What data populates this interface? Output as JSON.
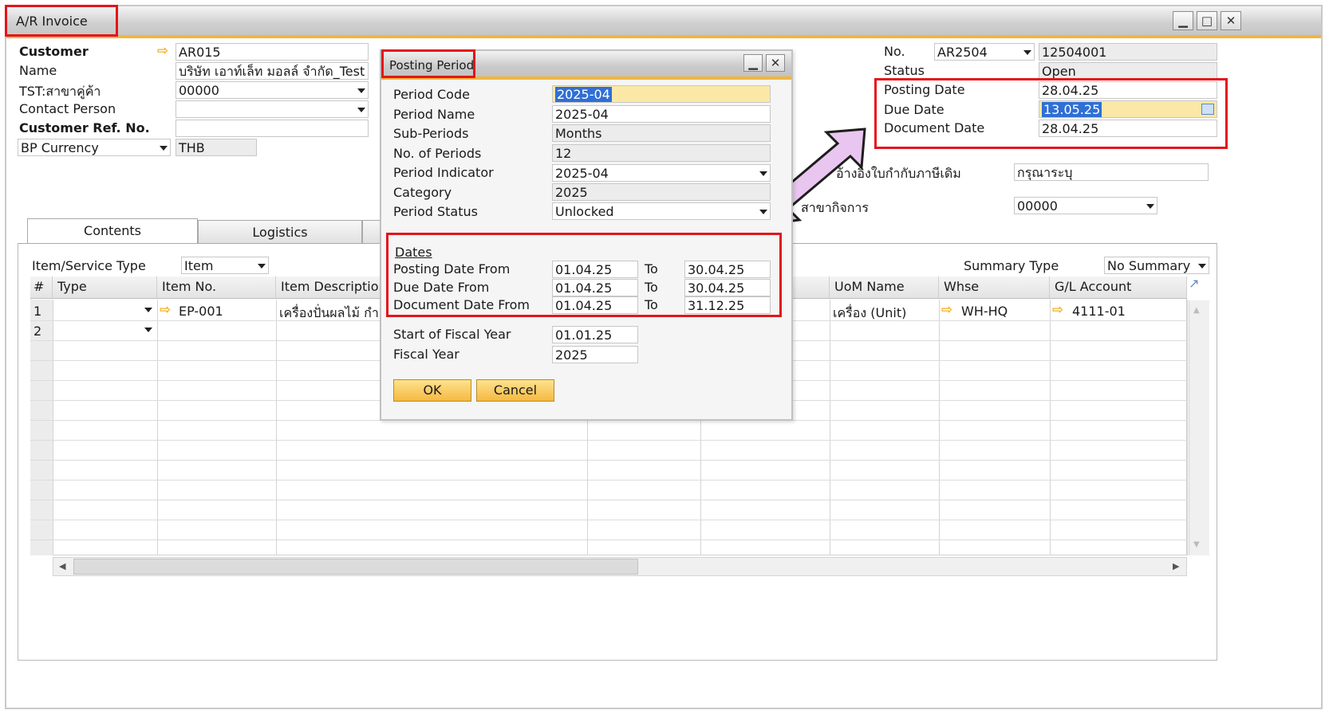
{
  "window": {
    "title": "A/R Invoice",
    "min": "▁",
    "max": "□",
    "close": "✕"
  },
  "header": {
    "customer_label": "Customer",
    "customer_value": "AR015",
    "name_label": "Name",
    "name_value": "บริษัท เอาท์เล็ท มอลล์ จำกัด_Test",
    "branch_label": "TST:สาขาคู่ค้า",
    "branch_value": "00000",
    "contact_label": "Contact Person",
    "contact_value": "",
    "custref_label": "Customer Ref. No.",
    "custref_value": "",
    "currency_label": "BP Currency",
    "currency_value": "THB",
    "no_label": "No.",
    "no_series": "AR2504",
    "no_value": "12504001",
    "status_label": "Status",
    "status_value": "Open",
    "posting_date_label": "Posting Date",
    "posting_date_value": "28.04.25",
    "due_date_label": "Due Date",
    "due_date_value": "13.05.25",
    "document_date_label": "Document Date",
    "document_date_value": "28.04.25",
    "tax_label": "อ้างอิงใบกำกับภาษีเดิม",
    "tax_value": "กรุณาระบุ",
    "biz_branch_label": "สาขากิจการ",
    "biz_branch_value": "00000"
  },
  "tabs": [
    {
      "label": "Contents"
    },
    {
      "label": "Logistics"
    }
  ],
  "contents": {
    "item_type_label": "Item/Service Type",
    "item_type_value": "Item",
    "summary_label": "Summary Type",
    "summary_value": "No Summary",
    "columns": [
      "#",
      "Type",
      "Item No.",
      "Item Description",
      "UoM Name",
      "Whse",
      "G/L Account"
    ],
    "rows": [
      {
        "num": "1",
        "type": "",
        "item_no": "EP-001",
        "desc": "เครื่องปั่นผลไม้ กำลั",
        "uom": "เครื่อง (Unit)",
        "whse": "WH-HQ",
        "gl": "4111-01"
      },
      {
        "num": "2",
        "type": "",
        "item_no": "",
        "desc": "",
        "uom": "",
        "whse": "",
        "gl": ""
      }
    ]
  },
  "dialog": {
    "title": "Posting Period",
    "period_code_label": "Period Code",
    "period_code_value": "2025-04",
    "period_name_label": "Period Name",
    "period_name_value": "2025-04",
    "sub_periods_label": "Sub-Periods",
    "sub_periods_value": "Months",
    "num_periods_label": "No. of Periods",
    "num_periods_value": "12",
    "indicator_label": "Period Indicator",
    "indicator_value": "2025-04",
    "category_label": "Category",
    "category_value": "2025",
    "status_label": "Period Status",
    "status_value": "Unlocked",
    "dates_header": "Dates",
    "to_label": "To",
    "posting_from_label": "Posting Date From",
    "posting_from": "01.04.25",
    "posting_to": "30.04.25",
    "due_from_label": "Due Date From",
    "due_from": "01.04.25",
    "due_to": "30.04.25",
    "doc_from_label": "Document Date From",
    "doc_from": "01.04.25",
    "doc_to": "31.12.25",
    "fiscal_start_label": "Start of Fiscal Year",
    "fiscal_start_value": "01.01.25",
    "fiscal_year_label": "Fiscal Year",
    "fiscal_year_value": "2025",
    "ok_label": "OK",
    "cancel_label": "Cancel"
  },
  "colors": {
    "highlight": "#e3141b",
    "accent": "#f3b53a",
    "arrow_fill": "#e9c6ef"
  }
}
